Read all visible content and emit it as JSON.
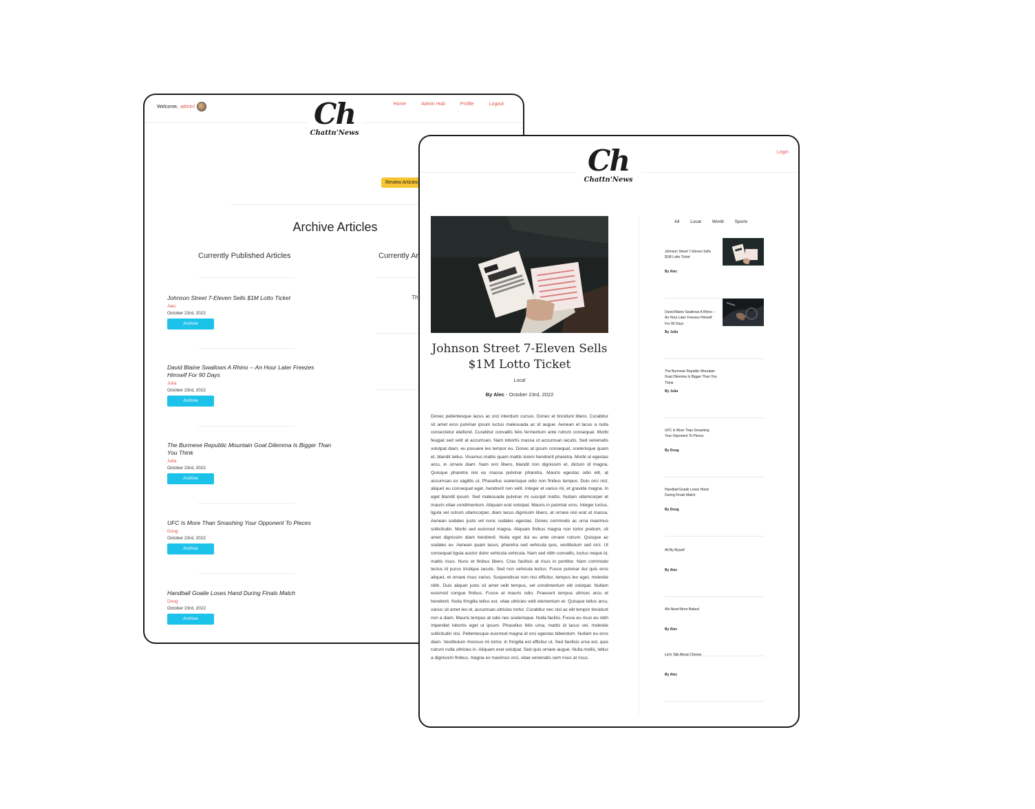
{
  "admin": {
    "welcome_prefix": "Welcome,",
    "username": "admin!",
    "nav": [
      "Home",
      "Admin Hub",
      "Profile",
      "Logout"
    ],
    "logo_mark": "Ch",
    "logo_word": "Chattn'News",
    "review_button": "Review Articles",
    "archive_title": "Archive Articles",
    "col_published": "Currently Published Articles",
    "col_other": "Currently Ar",
    "ghost_text": "Th",
    "articles": [
      {
        "title": "Johnson Street 7-Eleven Sells $1M Lotto Ticket",
        "author": "Alec",
        "date": "October 23rd, 2022",
        "button": "Archive"
      },
      {
        "title": "David Blaine Swallows A Rhino -- An Hour Later Freezes Himself For 90 Days",
        "author": "Julia",
        "date": "October 23rd, 2022",
        "button": "Archive"
      },
      {
        "title": "The Burmese Republic Mountain Goat Dilemma Is Bigger Than You Think",
        "author": "Julia",
        "date": "October 23rd, 2022",
        "button": "Archive"
      },
      {
        "title": "UFC Is More Than Smashing Your Opponent To Pieces",
        "author": "Doug",
        "date": "October 23rd, 2022",
        "button": "Archive"
      },
      {
        "title": "Handball Goalie Loses Hand During Finals Match",
        "author": "Doug",
        "date": "October 23rd, 2022",
        "button": "Archive"
      }
    ]
  },
  "article_page": {
    "login": "Login",
    "logo_mark": "Ch",
    "logo_word": "Chattn'News",
    "title": "Johnson Street 7-Eleven Sells $1M Lotto Ticket",
    "category": "Local",
    "byline_author": "By Alec",
    "byline_date": " - October 23rd, 2022",
    "body": "Donec pellentesque lacus ac orci interdum cursus. Donec et tincidunt libero. Curabitur sit amet eros pulvinar ipsum luctus malesuada ac id augue. Aenean et lacus a nulla consectetur eleifend. Curabitur convallis felis fermentum ante rutrum consequat. Morbi feugiat sed velit at accumsan. Nam lobortis massa ut accumsan iaculis. Sed venenatis volutpat diam, eu posuere leo tempor eu. Donec at ipsum consequat, scelerisque quam et, blandit tellus. Vivamus mattis quam mattis lorem hendrerit pharetra. Morbi ut egestas arcu, in ornare diam. Nam orci libero, blandit non dignissim et, dictum id magna. Quisque pharetra nisi eu massa pulvinar pharetra. Mauris egestas odio elit, at accumsan ex sagittis ut. Phasellus scelerisque odio non finibus tempus. Duis orci nisl, aliquet eu consequat eget, hendrerit non velit. Integer et varius mi, et gravida magna. In eget blandit ipsum. Sed malesuada pulvinar mi suscipit mattis. Nullam ullamcorper et mauris vitae condimentum. Aliquam erat volutpat. Mauris in pulvinar eros. Integer luctus, ligula vel rutrum ullamcorper, diam lacus dignissim libero, at ornare nisi erat at massa. Aenean sodales justo vel nunc sodales egestas. Donec commodo ac urna maximus sollicitudin. Morbi sed euismod magna. Aliquam finibus magna non tortor pretium, sit amet dignissim diam hendrerit. Nulla eget dui eu ante ornare rutrum. Quisque ac sodales ex. Aenean quam lacus, pharetra sed vehicula quis, vestibulum sed orci. Ut consequat ligula auctor dolor vehicula vehicula. Nam sed nibh convallis, luctus neque id, mattis risus. Nunc et finibus libero. Cras facilisis at risus in porttitor. Nam commodo lectus id purus tristique iaculis. Sed non vehicula lectus. Fusce pulvinar dui quis eros aliquet, et ornare risus varius. Suspendisse non nisi efficitur, tempus leo eget, molestie nibh. Duis aliquet justo sit amet velit tempus, vel condimentum elit volutpat. Nullam euismod congue finibus. Fusce at mauris odio. Praesent tempus ultrices arcu et hendrerit. Nulla fringilla tellus est, vitae ultricies velit elementum et. Quisque tellus arcu, varius sit amet leo id, accumsan ultricies tortor. Curabitur nec nisl ac elit tempor tincidunt non a diam. Mauris tempus at odio nec scelerisque. Nulla facilisi. Fusce eu risus eu nibh imperdiet lobortis eget ut ipsum. Phasellus felis urna, mattis id lacus vel, molestie sollicitudin nisi. Pellentesque euismod magna id orci egestas bibendum. Nullam eu eros diam. Vestibulum rhoncus mi tortor, in fringilla est efficitur ut. Sed facilisis urna est, quis rutrum nulla ultricies in. Aliquam erat volutpat. Sed quis ornare augue. Nulla mollis, tellus a dignissim finibus, magna ex maximus orci, vitae venenatis sem risus at risus.",
    "categories": [
      "All",
      "Local",
      "World",
      "Sports"
    ],
    "sidebar": [
      {
        "title": "Johnson Street 7-Eleven Sells $1M Lotto Ticket",
        "author": "By Alec",
        "thumb": "lotto"
      },
      {
        "title": "David Blaine Swallows A Rhino -- An Hour Later Freezes Himself For 90 Days",
        "author": "By Julia",
        "thumb": "car"
      },
      {
        "title": "The Burmese Republic Mountain Goat Dilemma Is Bigger Than You Think",
        "author": "By Julia",
        "thumb": null
      },
      {
        "title": "UFC Is More Than Smashing Your Opponent To Pieces",
        "author": "By Doug",
        "thumb": null
      },
      {
        "title": "Handball Goalie Loses Hand During Finals Match",
        "author": "By Doug",
        "thumb": null
      },
      {
        "title": "All By Myself",
        "author": "By Alec",
        "thumb": null
      },
      {
        "title": "We Need More Babes!",
        "author": "By Alec",
        "thumb": null
      },
      {
        "title": "Let's Talk About Cheese",
        "author": "By Alec",
        "thumb": null
      }
    ]
  },
  "colors": {
    "accent": "#e0524a",
    "archive_button": "#1cc2ea",
    "review_button": "#f7c531"
  }
}
